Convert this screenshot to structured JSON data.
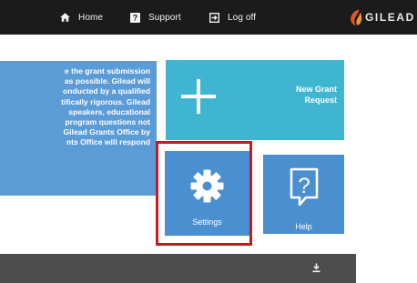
{
  "nav": {
    "home": {
      "label": "Home",
      "icon": "home-icon"
    },
    "support": {
      "label": "Support",
      "icon": "help-icon"
    },
    "logoff": {
      "label": "Log off",
      "icon": "sign-out-icon"
    }
  },
  "brand": {
    "name": "GILEAD",
    "icon": "gilead-logo-icon"
  },
  "info": {
    "lines": [
      "e the grant submission",
      "as possible. Gilead will",
      "onducted by a qualified",
      "tifically rigorous. Gilead",
      "speakers, educational",
      "program questions not",
      "Gilead Grants Office by",
      "nts Office will respond"
    ]
  },
  "tiles": {
    "new_grant": {
      "label": "New Grant Request",
      "icon": "plus-icon"
    },
    "settings": {
      "label": "Settings",
      "icon": "gear-icon"
    },
    "help": {
      "label": "Help",
      "icon": "question-icon"
    }
  },
  "bar": {
    "icon": "download-icon"
  },
  "colors": {
    "topbar": "#1b1b1b",
    "info_panel": "#5b9bd6",
    "tile_new": "#3fb5d2",
    "tile_blue": "#4a8fd0",
    "highlight": "#c11d21",
    "bar": "#4d4d4d"
  }
}
